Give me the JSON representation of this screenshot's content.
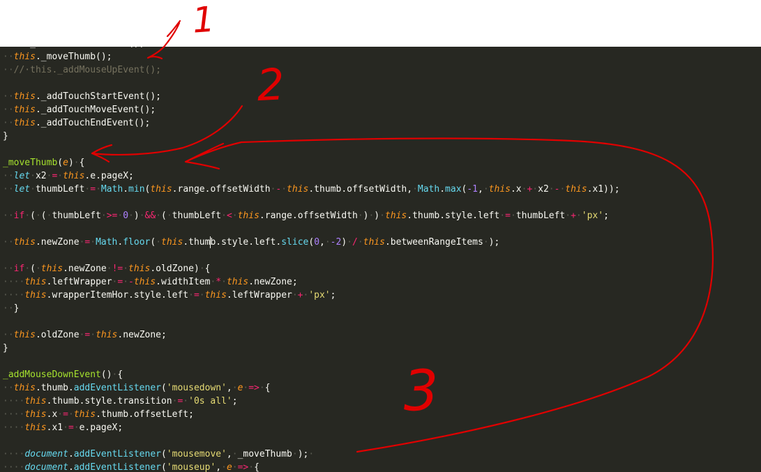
{
  "editor": {
    "lines": [
      [
        {
          "c": "x",
          "t": "this._addMouseDownEvent();"
        }
      ],
      [
        {
          "c": "ws",
          "t": "··"
        },
        {
          "c": "th",
          "t": "this"
        },
        {
          "c": "x",
          "t": "._moveThumb();"
        }
      ],
      [
        {
          "c": "ws",
          "t": "··"
        },
        {
          "c": "c",
          "t": "//·this._addMouseUpEvent();"
        }
      ],
      [],
      [
        {
          "c": "ws",
          "t": "··"
        },
        {
          "c": "th",
          "t": "this"
        },
        {
          "c": "x",
          "t": "._addTouchStartEvent();"
        }
      ],
      [
        {
          "c": "ws",
          "t": "··"
        },
        {
          "c": "th",
          "t": "this"
        },
        {
          "c": "x",
          "t": "._addTouchMoveEvent();"
        }
      ],
      [
        {
          "c": "ws",
          "t": "··"
        },
        {
          "c": "th",
          "t": "this"
        },
        {
          "c": "x",
          "t": "._addTouchEndEvent();"
        }
      ],
      [
        {
          "c": "x",
          "t": "}"
        }
      ],
      [],
      [
        {
          "c": "f",
          "t": "_moveThumb"
        },
        {
          "c": "x",
          "t": "("
        },
        {
          "c": "p",
          "t": "e"
        },
        {
          "c": "x",
          "t": ")"
        },
        {
          "c": "ws",
          "t": "·"
        },
        {
          "c": "x",
          "t": "{"
        }
      ],
      [
        {
          "c": "ws",
          "t": "··"
        },
        {
          "c": "d",
          "t": "let"
        },
        {
          "c": "ws",
          "t": "·"
        },
        {
          "c": "x",
          "t": "x2"
        },
        {
          "c": "ws",
          "t": "·"
        },
        {
          "c": "k",
          "t": "="
        },
        {
          "c": "ws",
          "t": "·"
        },
        {
          "c": "th",
          "t": "this"
        },
        {
          "c": "x",
          "t": ".e.pageX;"
        }
      ],
      [
        {
          "c": "ws",
          "t": "··"
        },
        {
          "c": "d",
          "t": "let"
        },
        {
          "c": "ws",
          "t": "·"
        },
        {
          "c": "x",
          "t": "thumbLeft"
        },
        {
          "c": "ws",
          "t": "·"
        },
        {
          "c": "k",
          "t": "="
        },
        {
          "c": "ws",
          "t": "·"
        },
        {
          "c": "b",
          "t": "Math"
        },
        {
          "c": "x",
          "t": "."
        },
        {
          "c": "b",
          "t": "min"
        },
        {
          "c": "x",
          "t": "("
        },
        {
          "c": "th",
          "t": "this"
        },
        {
          "c": "x",
          "t": ".range.offsetWidth"
        },
        {
          "c": "ws",
          "t": "·"
        },
        {
          "c": "k",
          "t": "-"
        },
        {
          "c": "ws",
          "t": "·"
        },
        {
          "c": "th",
          "t": "this"
        },
        {
          "c": "x",
          "t": ".thumb.offsetWidth,"
        },
        {
          "c": "ws",
          "t": "·"
        },
        {
          "c": "b",
          "t": "Math"
        },
        {
          "c": "x",
          "t": "."
        },
        {
          "c": "b",
          "t": "max"
        },
        {
          "c": "x",
          "t": "("
        },
        {
          "c": "n",
          "t": "-1"
        },
        {
          "c": "x",
          "t": ","
        },
        {
          "c": "ws",
          "t": "·"
        },
        {
          "c": "th",
          "t": "this"
        },
        {
          "c": "x",
          "t": ".x"
        },
        {
          "c": "ws",
          "t": "·"
        },
        {
          "c": "k",
          "t": "+"
        },
        {
          "c": "ws",
          "t": "·"
        },
        {
          "c": "x",
          "t": "x2"
        },
        {
          "c": "ws",
          "t": "·"
        },
        {
          "c": "k",
          "t": "-"
        },
        {
          "c": "ws",
          "t": "·"
        },
        {
          "c": "th",
          "t": "this"
        },
        {
          "c": "x",
          "t": ".x1));"
        }
      ],
      [],
      [
        {
          "c": "ws",
          "t": "··"
        },
        {
          "c": "k",
          "t": "if"
        },
        {
          "c": "ws",
          "t": "·"
        },
        {
          "c": "x",
          "t": "("
        },
        {
          "c": "ws",
          "t": "·"
        },
        {
          "c": "x",
          "t": "("
        },
        {
          "c": "ws",
          "t": "·"
        },
        {
          "c": "x",
          "t": "thumbLeft"
        },
        {
          "c": "ws",
          "t": "·"
        },
        {
          "c": "k",
          "t": ">="
        },
        {
          "c": "ws",
          "t": "·"
        },
        {
          "c": "n",
          "t": "0"
        },
        {
          "c": "ws",
          "t": "·"
        },
        {
          "c": "x",
          "t": ")"
        },
        {
          "c": "ws",
          "t": "·"
        },
        {
          "c": "k",
          "t": "&&"
        },
        {
          "c": "ws",
          "t": "·"
        },
        {
          "c": "x",
          "t": "("
        },
        {
          "c": "ws",
          "t": "·"
        },
        {
          "c": "x",
          "t": "thumbLeft"
        },
        {
          "c": "ws",
          "t": "·"
        },
        {
          "c": "k",
          "t": "<"
        },
        {
          "c": "ws",
          "t": "·"
        },
        {
          "c": "th",
          "t": "this"
        },
        {
          "c": "x",
          "t": ".range.offsetWidth"
        },
        {
          "c": "ws",
          "t": "·"
        },
        {
          "c": "x",
          "t": ")"
        },
        {
          "c": "ws",
          "t": "·"
        },
        {
          "c": "x",
          "t": ")"
        },
        {
          "c": "ws",
          "t": "·"
        },
        {
          "c": "th",
          "t": "this"
        },
        {
          "c": "x",
          "t": ".thumb.style.left"
        },
        {
          "c": "ws",
          "t": "·"
        },
        {
          "c": "k",
          "t": "="
        },
        {
          "c": "ws",
          "t": "·"
        },
        {
          "c": "x",
          "t": "thumbLeft"
        },
        {
          "c": "ws",
          "t": "·"
        },
        {
          "c": "k",
          "t": "+"
        },
        {
          "c": "ws",
          "t": "·"
        },
        {
          "c": "s",
          "t": "'px'"
        },
        {
          "c": "x",
          "t": ";"
        }
      ],
      [],
      [
        {
          "c": "ws",
          "t": "··"
        },
        {
          "c": "th",
          "t": "this"
        },
        {
          "c": "x",
          "t": ".newZone"
        },
        {
          "c": "ws",
          "t": "·"
        },
        {
          "c": "k",
          "t": "="
        },
        {
          "c": "ws",
          "t": "·"
        },
        {
          "c": "b",
          "t": "Math"
        },
        {
          "c": "x",
          "t": "."
        },
        {
          "c": "b",
          "t": "floor"
        },
        {
          "c": "x",
          "t": "("
        },
        {
          "c": "ws",
          "t": "·"
        },
        {
          "c": "th",
          "t": "this"
        },
        {
          "c": "x",
          "t": ".thumb.style.left."
        },
        {
          "c": "b",
          "t": "slice"
        },
        {
          "c": "x",
          "t": "("
        },
        {
          "c": "n",
          "t": "0"
        },
        {
          "c": "x",
          "t": ","
        },
        {
          "c": "ws",
          "t": "·"
        },
        {
          "c": "n",
          "t": "-2"
        },
        {
          "c": "x",
          "t": ")"
        },
        {
          "c": "ws",
          "t": "·"
        },
        {
          "c": "k",
          "t": "/"
        },
        {
          "c": "ws",
          "t": "·"
        },
        {
          "c": "th",
          "t": "this"
        },
        {
          "c": "x",
          "t": ".betweenRangeItems"
        },
        {
          "c": "ws",
          "t": "·"
        },
        {
          "c": "x",
          "t": ");"
        }
      ],
      [],
      [
        {
          "c": "ws",
          "t": "··"
        },
        {
          "c": "k",
          "t": "if"
        },
        {
          "c": "ws",
          "t": "·"
        },
        {
          "c": "x",
          "t": "("
        },
        {
          "c": "ws",
          "t": "·"
        },
        {
          "c": "th",
          "t": "this"
        },
        {
          "c": "x",
          "t": ".newZone"
        },
        {
          "c": "ws",
          "t": "·"
        },
        {
          "c": "k",
          "t": "!="
        },
        {
          "c": "ws",
          "t": "·"
        },
        {
          "c": "th",
          "t": "this"
        },
        {
          "c": "x",
          "t": ".oldZone)"
        },
        {
          "c": "ws",
          "t": "·"
        },
        {
          "c": "x",
          "t": "{"
        }
      ],
      [
        {
          "c": "ws",
          "t": "····"
        },
        {
          "c": "th",
          "t": "this"
        },
        {
          "c": "x",
          "t": ".leftWrapper"
        },
        {
          "c": "ws",
          "t": "·"
        },
        {
          "c": "k",
          "t": "="
        },
        {
          "c": "ws",
          "t": "·"
        },
        {
          "c": "k",
          "t": "-"
        },
        {
          "c": "th",
          "t": "this"
        },
        {
          "c": "x",
          "t": ".widthItem"
        },
        {
          "c": "ws",
          "t": "·"
        },
        {
          "c": "k",
          "t": "*"
        },
        {
          "c": "ws",
          "t": "·"
        },
        {
          "c": "th",
          "t": "this"
        },
        {
          "c": "x",
          "t": ".newZone;"
        }
      ],
      [
        {
          "c": "ws",
          "t": "····"
        },
        {
          "c": "th",
          "t": "this"
        },
        {
          "c": "x",
          "t": ".wrapperItemHor.style.left"
        },
        {
          "c": "ws",
          "t": "·"
        },
        {
          "c": "k",
          "t": "="
        },
        {
          "c": "ws",
          "t": "·"
        },
        {
          "c": "th",
          "t": "this"
        },
        {
          "c": "x",
          "t": ".leftWrapper"
        },
        {
          "c": "ws",
          "t": "·"
        },
        {
          "c": "k",
          "t": "+"
        },
        {
          "c": "ws",
          "t": "·"
        },
        {
          "c": "s",
          "t": "'px'"
        },
        {
          "c": "x",
          "t": ";"
        }
      ],
      [
        {
          "c": "ws",
          "t": "··"
        },
        {
          "c": "x",
          "t": "}"
        }
      ],
      [],
      [
        {
          "c": "ws",
          "t": "··"
        },
        {
          "c": "th",
          "t": "this"
        },
        {
          "c": "x",
          "t": ".oldZone"
        },
        {
          "c": "ws",
          "t": "·"
        },
        {
          "c": "k",
          "t": "="
        },
        {
          "c": "ws",
          "t": "·"
        },
        {
          "c": "th",
          "t": "this"
        },
        {
          "c": "x",
          "t": ".newZone;"
        }
      ],
      [
        {
          "c": "x",
          "t": "}"
        }
      ],
      [],
      [
        {
          "c": "f",
          "t": "_addMouseDownEvent"
        },
        {
          "c": "x",
          "t": "()"
        },
        {
          "c": "ws",
          "t": "·"
        },
        {
          "c": "x",
          "t": "{"
        }
      ],
      [
        {
          "c": "ws",
          "t": "··"
        },
        {
          "c": "th",
          "t": "this"
        },
        {
          "c": "x",
          "t": ".thumb."
        },
        {
          "c": "b",
          "t": "addEventListener"
        },
        {
          "c": "x",
          "t": "("
        },
        {
          "c": "s",
          "t": "'mousedown'"
        },
        {
          "c": "x",
          "t": ","
        },
        {
          "c": "ws",
          "t": "·"
        },
        {
          "c": "p",
          "t": "e"
        },
        {
          "c": "ws",
          "t": "·"
        },
        {
          "c": "k",
          "t": "=>"
        },
        {
          "c": "ws",
          "t": "·"
        },
        {
          "c": "x",
          "t": "{"
        }
      ],
      [
        {
          "c": "ws",
          "t": "····"
        },
        {
          "c": "th",
          "t": "this"
        },
        {
          "c": "x",
          "t": ".thumb.style.transition"
        },
        {
          "c": "ws",
          "t": "·"
        },
        {
          "c": "k",
          "t": "="
        },
        {
          "c": "ws",
          "t": "·"
        },
        {
          "c": "s",
          "t": "'0s all'"
        },
        {
          "c": "x",
          "t": ";"
        }
      ],
      [
        {
          "c": "ws",
          "t": "····"
        },
        {
          "c": "th",
          "t": "this"
        },
        {
          "c": "x",
          "t": ".x"
        },
        {
          "c": "ws",
          "t": "·"
        },
        {
          "c": "k",
          "t": "="
        },
        {
          "c": "ws",
          "t": "·"
        },
        {
          "c": "th",
          "t": "this"
        },
        {
          "c": "x",
          "t": ".thumb.offsetLeft;"
        }
      ],
      [
        {
          "c": "ws",
          "t": "····"
        },
        {
          "c": "th",
          "t": "this"
        },
        {
          "c": "x",
          "t": ".x1"
        },
        {
          "c": "ws",
          "t": "·"
        },
        {
          "c": "k",
          "t": "="
        },
        {
          "c": "ws",
          "t": "·"
        },
        {
          "c": "x",
          "t": "e.pageX;"
        }
      ],
      [],
      [
        {
          "c": "ws",
          "t": "····"
        },
        {
          "c": "d",
          "t": "document"
        },
        {
          "c": "x",
          "t": "."
        },
        {
          "c": "b",
          "t": "addEventListener"
        },
        {
          "c": "x",
          "t": "("
        },
        {
          "c": "s",
          "t": "'mousemove'"
        },
        {
          "c": "x",
          "t": ","
        },
        {
          "c": "ws",
          "t": "·"
        },
        {
          "c": "x",
          "t": "_moveThumb"
        },
        {
          "c": "ws",
          "t": "·"
        },
        {
          "c": "x",
          "t": ");"
        },
        {
          "c": "ws",
          "t": "·"
        }
      ],
      [
        {
          "c": "ws",
          "t": "····"
        },
        {
          "c": "d",
          "t": "document"
        },
        {
          "c": "x",
          "t": "."
        },
        {
          "c": "b",
          "t": "addEventListener"
        },
        {
          "c": "x",
          "t": "("
        },
        {
          "c": "s",
          "t": "'mouseup'"
        },
        {
          "c": "x",
          "t": ","
        },
        {
          "c": "ws",
          "t": "·"
        },
        {
          "c": "p",
          "t": "e"
        },
        {
          "c": "ws",
          "t": "·"
        },
        {
          "c": "k",
          "t": "=>"
        },
        {
          "c": "ws",
          "t": "·"
        },
        {
          "c": "x",
          "t": "{"
        }
      ]
    ]
  },
  "annotations": {
    "labels": [
      "1",
      "2",
      "3"
    ],
    "color": "#e00000"
  },
  "theme": {
    "background": "#272822"
  }
}
